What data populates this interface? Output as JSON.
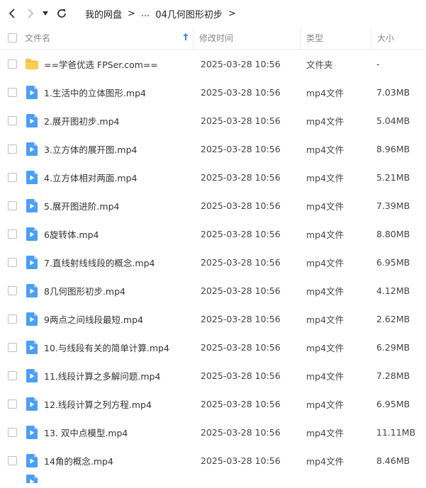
{
  "breadcrumb": {
    "root": "我的网盘",
    "ellipsis": "...",
    "current": "04几何图形初步",
    "sep": ">"
  },
  "header": {
    "name": "文件名",
    "time": "修改时间",
    "type": "类型",
    "size": "大小",
    "sort_icon": "arrow-up-icon"
  },
  "colors": {
    "accent": "#3a8ee6",
    "folder": "#f5c243",
    "video": "#4a9ff5"
  },
  "files": [
    {
      "name": "==学爸优选 FPSer.com==",
      "time": "2025-03-28 10:56",
      "type": "文件夹",
      "size": "-",
      "icon": "folder-icon"
    },
    {
      "name": "1.生活中的立体图形.mp4",
      "time": "2025-03-28 10:56",
      "type": "mp4文件",
      "size": "7.03MB",
      "icon": "video-file-icon"
    },
    {
      "name": "2.展开图初步.mp4",
      "time": "2025-03-28 10:56",
      "type": "mp4文件",
      "size": "5.04MB",
      "icon": "video-file-icon"
    },
    {
      "name": "3.立方体的展开图.mp4",
      "time": "2025-03-28 10:56",
      "type": "mp4文件",
      "size": "8.96MB",
      "icon": "video-file-icon"
    },
    {
      "name": "4.立方体相对两面.mp4",
      "time": "2025-03-28 10:56",
      "type": "mp4文件",
      "size": "5.21MB",
      "icon": "video-file-icon"
    },
    {
      "name": "5.展开图进阶.mp4",
      "time": "2025-03-28 10:56",
      "type": "mp4文件",
      "size": "7.39MB",
      "icon": "video-file-icon"
    },
    {
      "name": "6旋转体.mp4",
      "time": "2025-03-28 10:56",
      "type": "mp4文件",
      "size": "8.80MB",
      "icon": "video-file-icon"
    },
    {
      "name": "7.直线射线线段的概念.mp4",
      "time": "2025-03-28 10:56",
      "type": "mp4文件",
      "size": "6.95MB",
      "icon": "video-file-icon"
    },
    {
      "name": "8几何图形初步.mp4",
      "time": "2025-03-28 10:56",
      "type": "mp4文件",
      "size": "4.12MB",
      "icon": "video-file-icon"
    },
    {
      "name": "9两点之间线段最短.mp4",
      "time": "2025-03-28 10:56",
      "type": "mp4文件",
      "size": "2.62MB",
      "icon": "video-file-icon"
    },
    {
      "name": "10.与线段有关的简单计算.mp4",
      "time": "2025-03-28 10:56",
      "type": "mp4文件",
      "size": "6.29MB",
      "icon": "video-file-icon"
    },
    {
      "name": "11.线段计算之多解问题.mp4",
      "time": "2025-03-28 10:56",
      "type": "mp4文件",
      "size": "7.28MB",
      "icon": "video-file-icon"
    },
    {
      "name": "12.线段计算之列方程.mp4",
      "time": "2025-03-28 10:56",
      "type": "mp4文件",
      "size": "6.95MB",
      "icon": "video-file-icon"
    },
    {
      "name": "13. 双中点模型.mp4",
      "time": "2025-03-28 10:56",
      "type": "mp4文件",
      "size": "11.11MB",
      "icon": "video-file-icon"
    },
    {
      "name": "14角的概念.mp4",
      "time": "2025-03-28 10:56",
      "type": "mp4文件",
      "size": "8.46MB",
      "icon": "video-file-icon"
    }
  ]
}
